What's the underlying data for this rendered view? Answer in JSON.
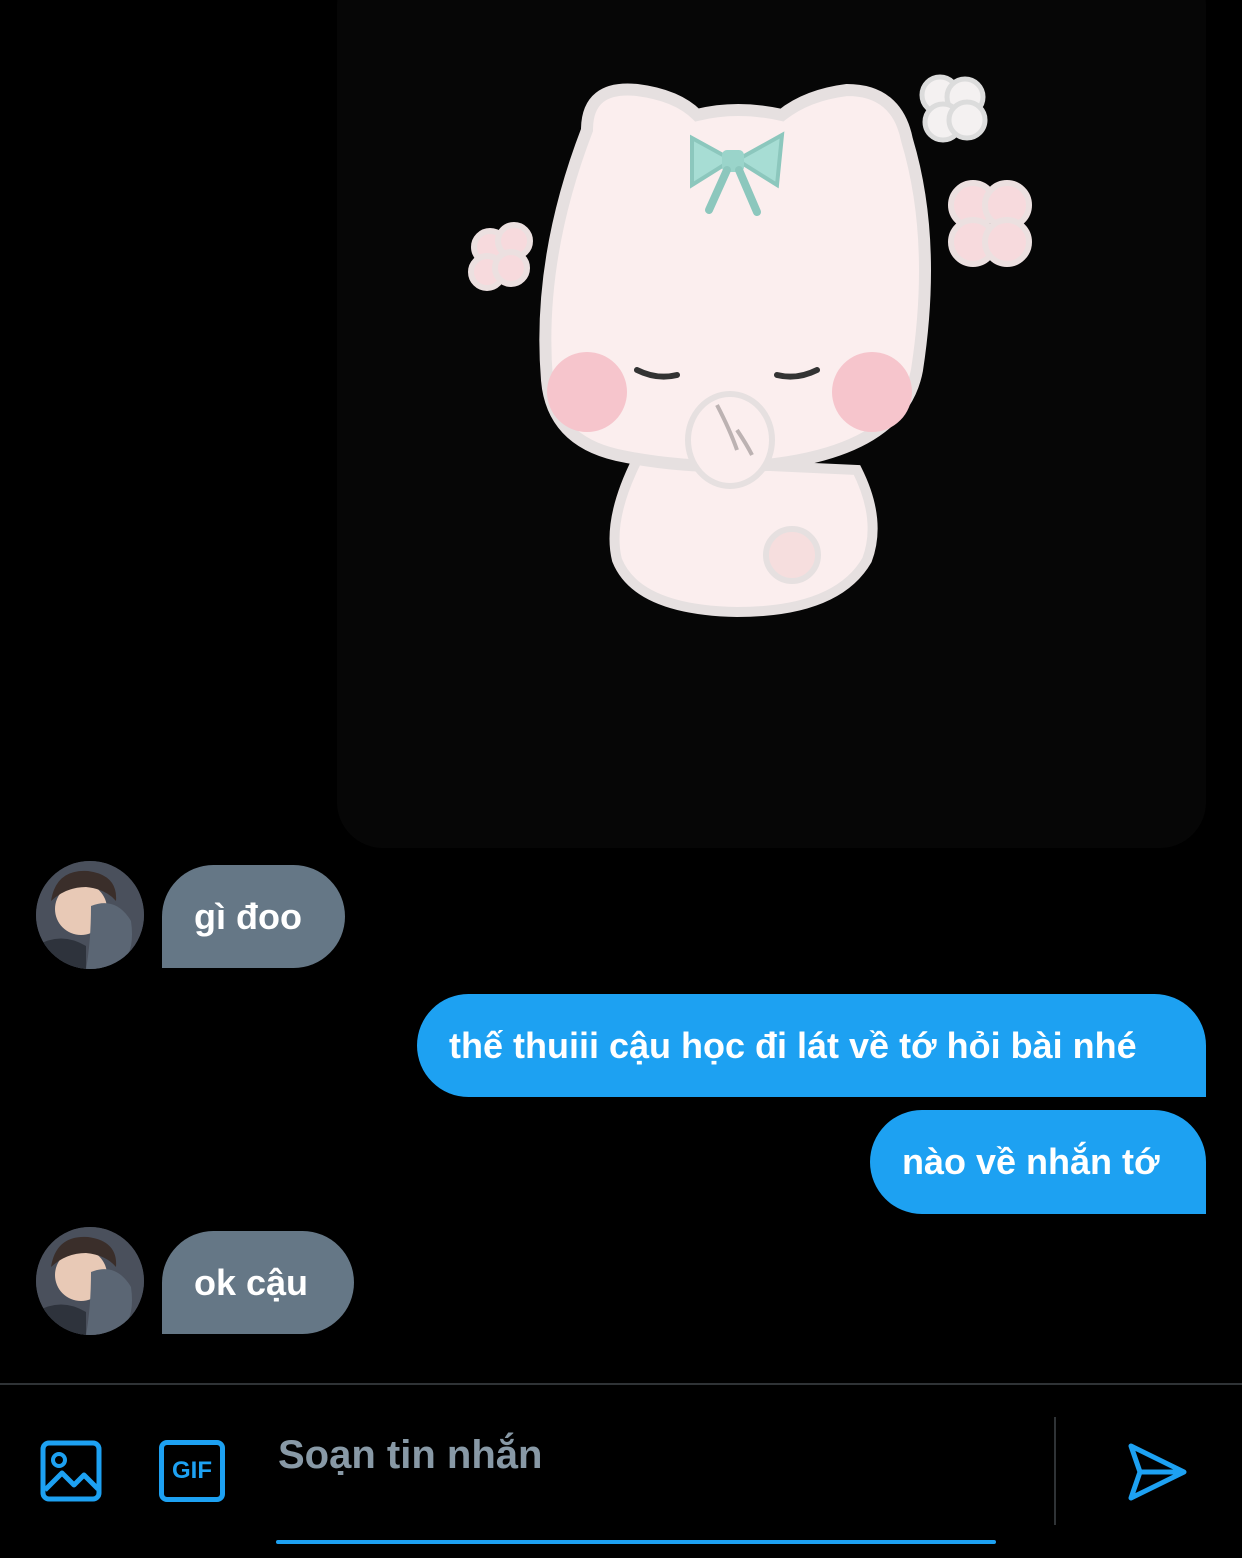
{
  "messages": [
    {
      "type": "image",
      "direction": "outgoing",
      "image": "sticker-bunny-with-mint-bow"
    },
    {
      "type": "text",
      "direction": "incoming",
      "text": "gì đoo",
      "avatar": "contact-avatar"
    },
    {
      "type": "text",
      "direction": "outgoing",
      "text": "thế thuiii cậu học đi lát về tớ hỏi bài nhé"
    },
    {
      "type": "text",
      "direction": "outgoing",
      "text": "nào về nhắn tớ"
    },
    {
      "type": "text",
      "direction": "incoming",
      "text": "ok cậu",
      "avatar": "contact-avatar"
    }
  ],
  "composer": {
    "placeholder": "Soạn tin nhắn",
    "image_icon": "image-icon",
    "gif_label": "GIF",
    "send_icon": "send-icon"
  },
  "colors": {
    "background": "#000000",
    "outgoing_bubble": "#1da1f2",
    "incoming_bubble": "#657786",
    "accent": "#1da1f2",
    "placeholder": "#8899a6"
  }
}
